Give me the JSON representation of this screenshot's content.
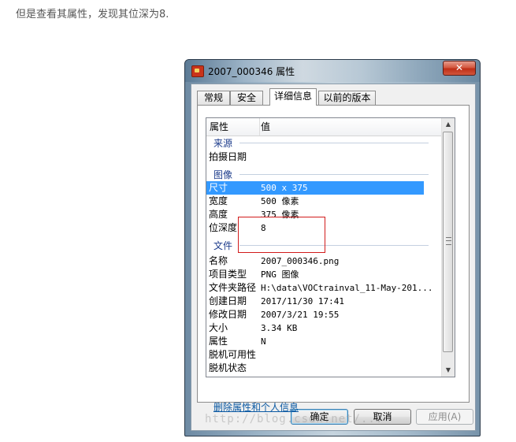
{
  "caption": "但是查看其属性，发现其位深为8.",
  "window": {
    "title": "2007_000346 属性",
    "close_glyph": "✕"
  },
  "tabs": [
    {
      "label": "常规",
      "active": false
    },
    {
      "label": "安全",
      "active": false
    },
    {
      "label": "详细信息",
      "active": true
    },
    {
      "label": "以前的版本",
      "active": false
    }
  ],
  "list": {
    "header": {
      "name": "属性",
      "value": "值"
    },
    "groups": {
      "source": "来源",
      "image": "图像",
      "file": "文件"
    },
    "source_rows": [
      {
        "key": "拍摄日期",
        "value": ""
      }
    ],
    "image_rows": [
      {
        "key": "尺寸",
        "value": "500 x 375",
        "selected": true
      },
      {
        "key": "宽度",
        "value": "500 像素"
      },
      {
        "key": "高度",
        "value": "375 像素"
      },
      {
        "key": "位深度",
        "value": "8"
      }
    ],
    "file_rows": [
      {
        "key": "名称",
        "value": "2007_000346.png"
      },
      {
        "key": "项目类型",
        "value": "PNG 图像"
      },
      {
        "key": "文件夹路径",
        "value": "H:\\data\\VOCtrainval_11-May-201..."
      },
      {
        "key": "创建日期",
        "value": "2017/11/30 17:41"
      },
      {
        "key": "修改日期",
        "value": "2007/3/21 19:55"
      },
      {
        "key": "大小",
        "value": "3.34 KB"
      },
      {
        "key": "属性",
        "value": "N"
      },
      {
        "key": "脱机可用性",
        "value": ""
      },
      {
        "key": "脱机状态",
        "value": ""
      }
    ]
  },
  "remove_link": "删除属性和个人信息",
  "buttons": {
    "ok": "确定",
    "cancel": "取消",
    "apply": "应用(A)"
  },
  "watermark": "http://blog.csdn.net/..."
}
